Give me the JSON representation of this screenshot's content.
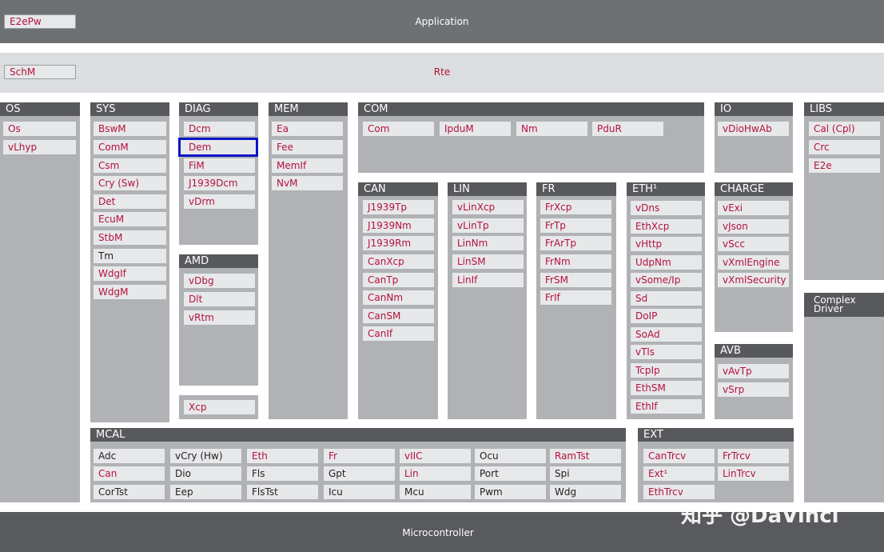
{
  "application": {
    "title": "Application",
    "module": "E2ePw"
  },
  "rte": {
    "title": "Rte",
    "module": "SchM"
  },
  "os": {
    "header": "OS",
    "modules": [
      "Os",
      "vLhyp"
    ]
  },
  "sys": {
    "header": "SYS",
    "modules": [
      "BswM",
      "ComM",
      "Csm",
      "Cry (Sw)",
      "Det",
      "EcuM",
      "StbM",
      "Tm",
      "WdgIf",
      "WdgM"
    ]
  },
  "diag": {
    "header": "DIAG",
    "modules": [
      "Dcm",
      "Dem",
      "FiM",
      "J1939Dcm",
      "vDrm"
    ],
    "selected": "Dem"
  },
  "amd": {
    "header": "AMD",
    "modules": [
      "vDbg",
      "Dlt",
      "vRtm"
    ]
  },
  "xcp": {
    "module": "Xcp"
  },
  "mem": {
    "header": "MEM",
    "modules": [
      "Ea",
      "Fee",
      "MemIf",
      "NvM"
    ]
  },
  "com": {
    "header": "COM",
    "modules": [
      "Com",
      "IpduM",
      "Nm",
      "PduR"
    ]
  },
  "can": {
    "header": "CAN",
    "modules": [
      "J1939Tp",
      "J1939Nm",
      "J1939Rm",
      "CanXcp",
      "CanTp",
      "CanNm",
      "CanSM",
      "CanIf"
    ]
  },
  "lin": {
    "header": "LIN",
    "modules": [
      "vLinXcp",
      "vLinTp",
      "LinNm",
      "LinSM",
      "LinIf"
    ]
  },
  "fr": {
    "header": "FR",
    "modules": [
      "FrXcp",
      "FrTp",
      "FrArTp",
      "FrNm",
      "FrSM",
      "FrIf"
    ]
  },
  "eth": {
    "header": "ETH¹",
    "modules": [
      "vDns",
      "EthXcp",
      "vHttp",
      "UdpNm",
      "vSome/Ip",
      "Sd",
      "DoIP",
      "SoAd",
      "vTls",
      "TcpIp",
      "EthSM",
      "EthIf"
    ]
  },
  "io": {
    "header": "IO",
    "modules": [
      "vDioHwAb"
    ]
  },
  "charge": {
    "header": "CHARGE",
    "modules": [
      "vExi",
      "vJson",
      "vScc",
      "vXmlEngine",
      "vXmlSecurity"
    ]
  },
  "avb": {
    "header": "AVB",
    "modules": [
      "vAvTp",
      "vSrp"
    ]
  },
  "libs": {
    "header": "LIBS",
    "modules": [
      "Cal (Cpl)",
      "Crc",
      "E2e"
    ]
  },
  "complex": {
    "line1": "Complex",
    "line2": "Driver"
  },
  "mcal": {
    "header": "MCAL",
    "rows": [
      [
        "Adc",
        "vCry (Hw)",
        "Eth",
        "Fr",
        "vIIC",
        "Ocu",
        "RamTst"
      ],
      [
        "Can",
        "Dio",
        "Fls",
        "Gpt",
        "Lin",
        "Port",
        "Spi"
      ],
      [
        "CorTst",
        "Eep",
        "FlsTst",
        "Icu",
        "Mcu",
        "Pwm",
        "Wdg"
      ]
    ]
  },
  "ext": {
    "header": "EXT",
    "modules": [
      "CanTrcv",
      "FrTrcv",
      "Ext¹",
      "LinTrcv",
      "EthTrcv"
    ]
  },
  "microcontroller": {
    "title": "Microcontroller"
  },
  "watermark": "知乎 @DaVinci",
  "colors": {
    "accent": "#b3123c",
    "selection": "#0a14c8",
    "header": "#58595c",
    "column": "#b1b2b5",
    "band": "#6e7174"
  }
}
